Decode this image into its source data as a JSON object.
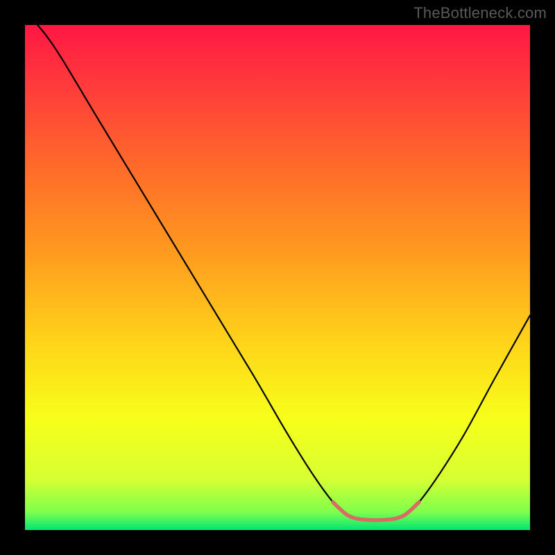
{
  "watermark": "TheBottleneck.com",
  "chart_data": {
    "type": "line",
    "title": "",
    "xlabel": "",
    "ylabel": "",
    "xlim": [
      0,
      100
    ],
    "ylim": [
      0,
      100
    ],
    "gradient_stops": [
      {
        "offset": 0.0,
        "color": "#ff1744"
      },
      {
        "offset": 0.12,
        "color": "#ff3b3b"
      },
      {
        "offset": 0.28,
        "color": "#ff6a2a"
      },
      {
        "offset": 0.45,
        "color": "#ff9a1f"
      },
      {
        "offset": 0.62,
        "color": "#ffd11a"
      },
      {
        "offset": 0.78,
        "color": "#f7ff1a"
      },
      {
        "offset": 0.9,
        "color": "#d6ff33"
      },
      {
        "offset": 0.965,
        "color": "#7dff4d"
      },
      {
        "offset": 1.0,
        "color": "#00e676"
      }
    ],
    "series": [
      {
        "name": "bottleneck-curve",
        "color": "#000000",
        "points": [
          {
            "x": 2.5,
            "y": 100
          },
          {
            "x": 4.5,
            "y": 97.5
          },
          {
            "x": 7.5,
            "y": 93
          },
          {
            "x": 15,
            "y": 80.5
          },
          {
            "x": 25,
            "y": 64
          },
          {
            "x": 35,
            "y": 47.5
          },
          {
            "x": 45,
            "y": 31
          },
          {
            "x": 52,
            "y": 19
          },
          {
            "x": 57,
            "y": 11
          },
          {
            "x": 61,
            "y": 5.5
          },
          {
            "x": 63.5,
            "y": 3.2
          },
          {
            "x": 65.5,
            "y": 2.3
          },
          {
            "x": 68,
            "y": 2.0
          },
          {
            "x": 71,
            "y": 2.0
          },
          {
            "x": 73.5,
            "y": 2.3
          },
          {
            "x": 75.5,
            "y": 3.2
          },
          {
            "x": 78,
            "y": 5.5
          },
          {
            "x": 82,
            "y": 11
          },
          {
            "x": 87,
            "y": 19
          },
          {
            "x": 93,
            "y": 30
          },
          {
            "x": 100,
            "y": 42.5
          }
        ]
      },
      {
        "name": "valley-marker",
        "color": "#d86b64",
        "stroke_width": 5.5,
        "points": [
          {
            "x": 61,
            "y": 5.5
          },
          {
            "x": 63.5,
            "y": 3.2
          },
          {
            "x": 65.5,
            "y": 2.3
          },
          {
            "x": 68,
            "y": 2.0
          },
          {
            "x": 71,
            "y": 2.0
          },
          {
            "x": 73.5,
            "y": 2.3
          },
          {
            "x": 75.5,
            "y": 3.2
          },
          {
            "x": 78,
            "y": 5.5
          }
        ]
      }
    ]
  }
}
